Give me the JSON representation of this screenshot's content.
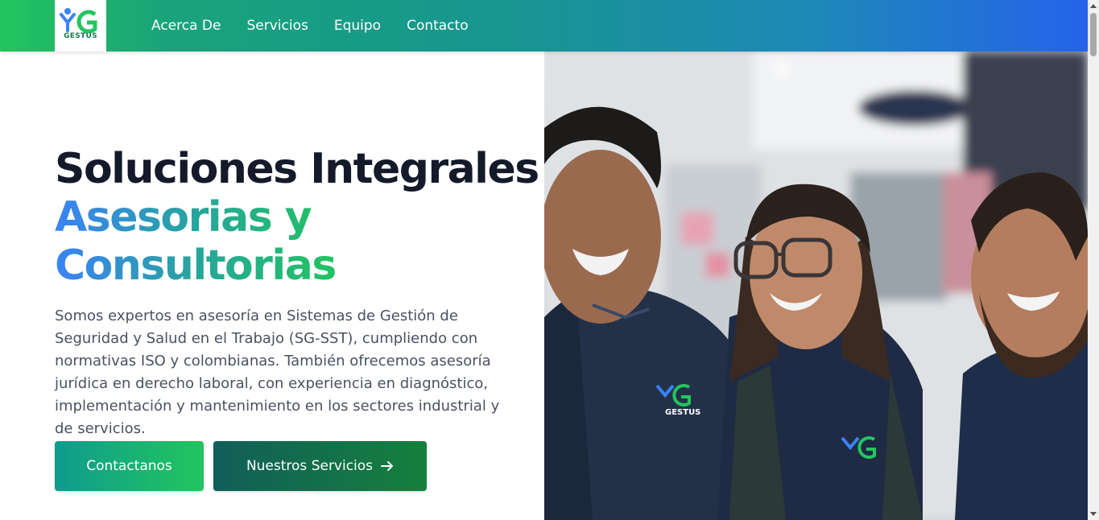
{
  "brand": {
    "logo_text": "GESTUS",
    "colors": {
      "green": "#22c55e",
      "teal": "#17968f",
      "blue": "#2563eb",
      "dark": "#141a2a"
    }
  },
  "nav": {
    "items": [
      {
        "label": "Acerca De"
      },
      {
        "label": "Servicios"
      },
      {
        "label": "Equipo"
      },
      {
        "label": "Contacto"
      }
    ]
  },
  "hero": {
    "title": "Soluciones Integrales",
    "subtitle": "Asesorias y Consultorias",
    "description": "Somos expertos en asesoría en Sistemas de Gestión de Seguridad y Salud en el Trabajo (SG-SST), cumpliendo con normativas ISO y colombianas. También ofrecemos asesoría jurídica en derecho laboral, con experiencia en diagnóstico, implementación y mantenimiento en los sectores industrial y de servicios.",
    "buttons": {
      "contact_label": "Contactanos",
      "services_label": "Nuestros Servicios",
      "services_icon": "arrow-right-icon"
    },
    "photo": {
      "vest_logo_text": "GESTUS"
    }
  }
}
